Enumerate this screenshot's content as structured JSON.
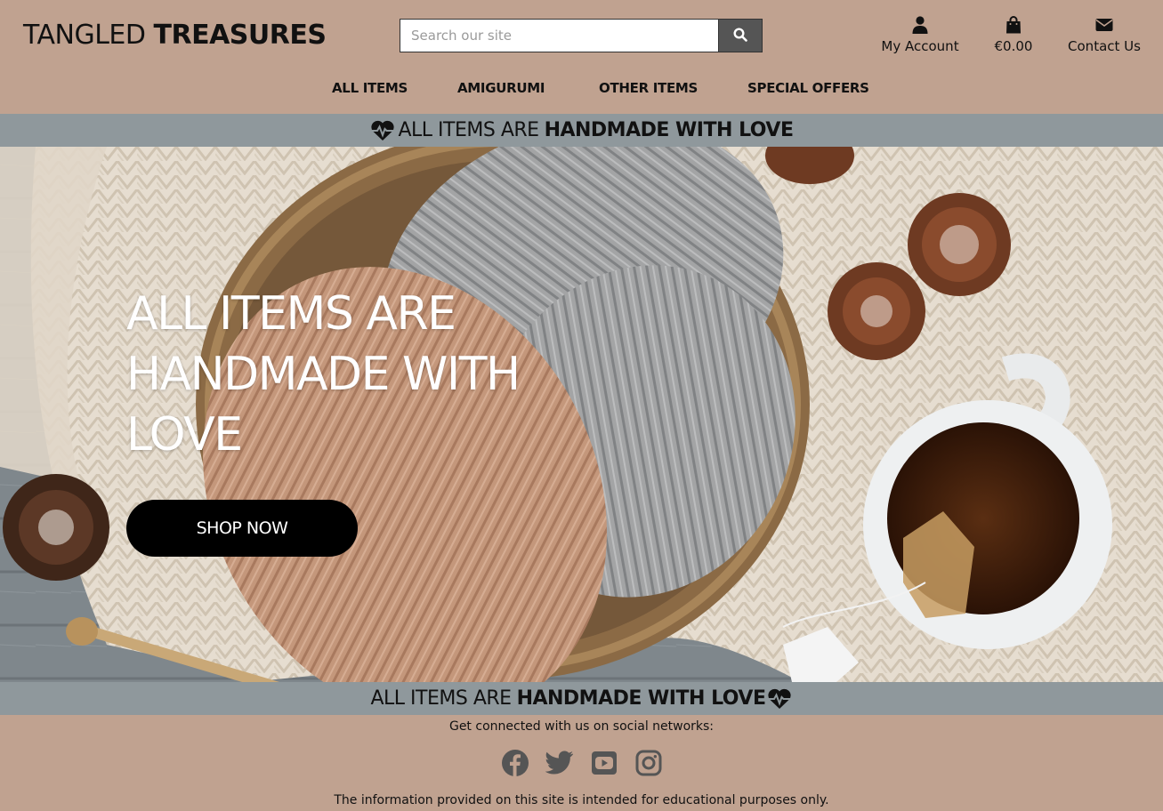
{
  "brand": {
    "light": "TANGLED",
    "bold": "TREASURES"
  },
  "search": {
    "placeholder": "Search our site",
    "value": ""
  },
  "header_links": {
    "account": "My Account",
    "bag_total": "€0.00",
    "contact": "Contact Us"
  },
  "nav": {
    "items": [
      {
        "label": "ALL ITEMS"
      },
      {
        "label": "AMIGURUMI"
      },
      {
        "label": "OTHER ITEMS"
      },
      {
        "label": "SPECIAL OFFERS"
      }
    ]
  },
  "banner": {
    "light": "ALL ITEMS ARE",
    "bold": "HANDMADE WITH LOVE"
  },
  "hero": {
    "title": "ALL ITEMS ARE HANDMADE WITH LOVE",
    "cta": "SHOP NOW"
  },
  "footer": {
    "connect": "Get connected with us on social networks:",
    "socials": [
      "facebook-icon",
      "twitter-icon",
      "youtube-icon",
      "instagram-icon"
    ],
    "disclaimer": "The information provided on this site is intended for educational purposes only."
  },
  "colors": {
    "header_bg": "#c0a290",
    "banner_bg": "#8f989c",
    "button_bg": "#000000",
    "search_button_bg": "#555555"
  },
  "icons": {
    "search": "search-icon",
    "account": "user-icon",
    "bag": "shopping-bag-icon",
    "contact": "envelope-icon",
    "banner": "heartbeat-icon"
  }
}
